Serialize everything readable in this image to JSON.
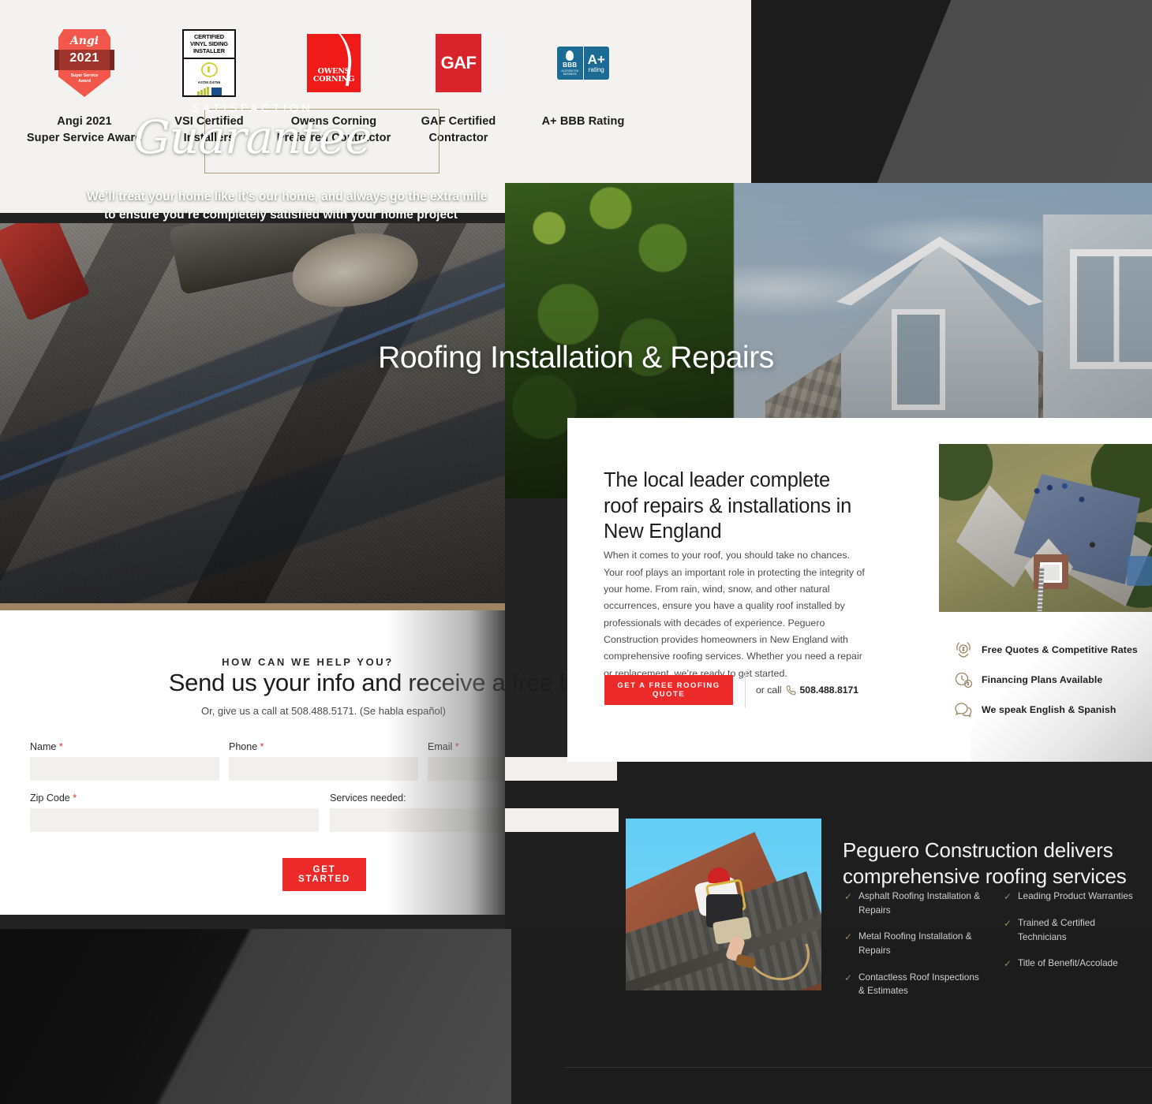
{
  "badges": {
    "items": [
      {
        "label_line1": "Angi 2021",
        "label_line2": "Super Service Award",
        "icon": "angi-shield-badge",
        "art": {
          "brand": "Angi",
          "year": "2021",
          "sub_line1": "Super Service",
          "sub_line2": "Award"
        }
      },
      {
        "label_line1": "VSI Certified",
        "label_line2": "Installers",
        "icon": "vsi-certificate-badge",
        "art": {
          "t1": "CERTIFIED",
          "t2": "VINYL SIDING",
          "t3": "INSTALLER",
          "astm": "ASTM D4756"
        }
      },
      {
        "label_line1": "Owens Corning",
        "label_line2": "Preferred Contractor",
        "icon": "owens-corning-logo",
        "art": {
          "t1": "OWENS",
          "t2": "CORNING"
        }
      },
      {
        "label_line1": "GAF Certified",
        "label_line2": "Contractor",
        "icon": "gaf-logo",
        "art": {
          "t1": "GAF"
        }
      },
      {
        "label_line1": "A+ BBB Rating",
        "label_line2": "",
        "icon": "bbb-a-plus-rating-badge",
        "art": {
          "t1": "BBB",
          "t2": "ACCREDITED BUSINESS",
          "t3": "A+",
          "t4": "rating"
        }
      }
    ]
  },
  "guarantee": {
    "eyebrow": "SATISFACTION",
    "script_word": "Guarantee",
    "sub_line1": "We’ll treat your home like it’s our home, and always go the extra mile",
    "sub_line2": "to ensure you’re completely satisfied with your home project"
  },
  "contact_form": {
    "eyebrow": "HOW CAN WE HELP YOU?",
    "title": "Send us your info and receive a free b",
    "callout": "Or, give us a call at 508.488.5171. (Se habla español)",
    "fields": [
      {
        "label": "Name",
        "required": true,
        "value": ""
      },
      {
        "label": "Phone",
        "required": true,
        "value": ""
      },
      {
        "label": "Email",
        "required": true,
        "value": ""
      },
      {
        "label": "Zip Code",
        "required": true,
        "value": ""
      },
      {
        "label": "Services needed:",
        "required": false,
        "value": ""
      }
    ],
    "submit_label": "GET STARTED"
  },
  "hero": {
    "title": "Roofing Installation & Repairs"
  },
  "intro_card": {
    "heading": "The local leader complete roof repairs & installations in New England",
    "body": "When it comes to your roof, you should take no chances. Your roof plays an important role in protecting the integrity of your home. From rain, wind, snow, and other natural occurrences, ensure you have a quality roof installed by professionals with decades of experience. Peguero Construction provides homeowners in New England with comprehensive roofing services. Whether you need a repair or replacement, we’re ready to get started.",
    "cta_label": "GET A FREE ROOFING QUOTE",
    "or_call_label": "or call",
    "phone": "508.488.8171",
    "benefits": [
      {
        "text": "Free Quotes & Competitive Rates",
        "icon": "laurel-dollar-icon"
      },
      {
        "text": "Financing Plans Available",
        "icon": "clock-dollar-icon"
      },
      {
        "text": "We speak English & Spanish",
        "icon": "speech-bubbles-icon"
      }
    ]
  },
  "services": {
    "title": "Peguero Construction delivers comprehensive roofing services",
    "column_left": [
      "Asphalt Roofing Installation & Repairs",
      "Metal Roofing Installation & Repairs",
      "Contactless Roof Inspections & Estimates"
    ],
    "column_right": [
      "Leading Product Warranties",
      "Trained & Certified Technicians",
      "Title of Benefit/Accolade"
    ]
  },
  "colors": {
    "accent_red": "#ed2a2a",
    "gold": "#9c8465",
    "badge_panel_bg": "#f3f2f0",
    "dark_bg": "#1e1e1e"
  }
}
